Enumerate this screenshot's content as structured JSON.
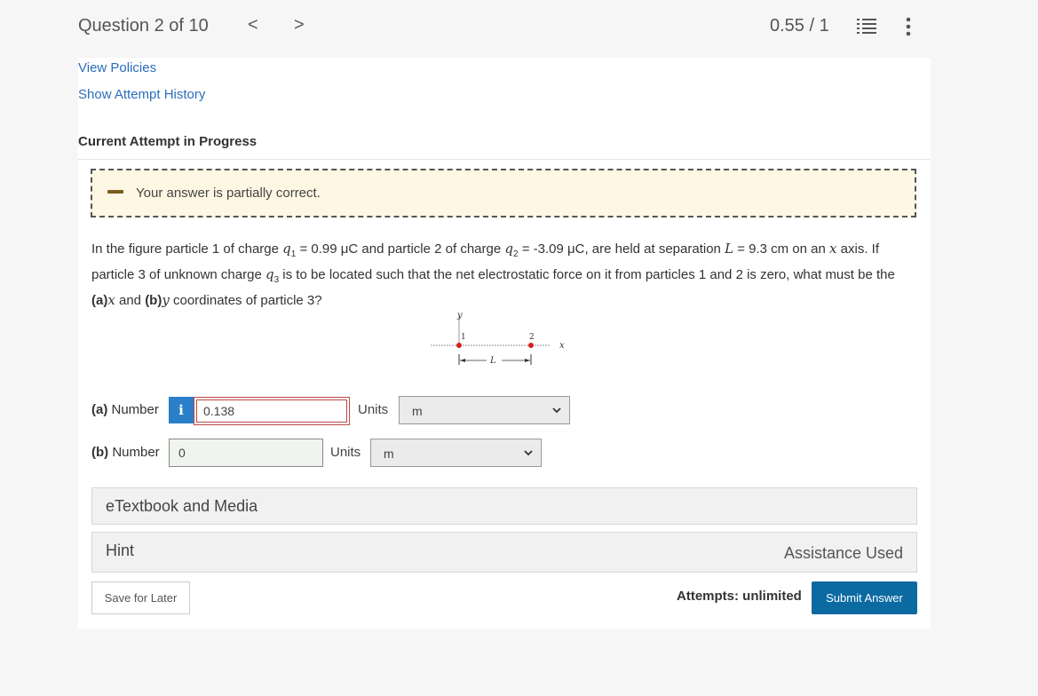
{
  "header": {
    "question_position": "Question 2 of 10",
    "prev_glyph": "<",
    "next_glyph": ">",
    "score": "0.55 / 1",
    "icons": [
      "list-icon",
      "more-vertical-icon"
    ]
  },
  "links": {
    "view_policies": "View Policies",
    "attempt_history": "Show Attempt History"
  },
  "attempt_heading": "Current Attempt in Progress",
  "feedback": {
    "text": "Your answer is partially correct.",
    "icon": "partial-dash-icon"
  },
  "question": {
    "p1": "In the figure particle 1 of charge ",
    "q1_var": "q",
    "q1_sub": "1",
    "q1_val": " = 0.99 μC and particle 2 of charge ",
    "q2_var": "q",
    "q2_sub": "2",
    "q2_val": " = -3.09 μC, are held at separation ",
    "L_var": "L",
    "L_val": " = 9.3 cm on an ",
    "x_var": "x",
    "p2": " axis. If particle 3 of unknown charge ",
    "q3_var": "q",
    "q3_sub": "3",
    "p3": " is to be located such that the net electrostatic force on it from particles 1 and 2 is zero, what must be the ",
    "a_label": "(a)",
    "a_var": "x",
    "p4": " and ",
    "b_label": "(b)",
    "b_var": "y",
    "p5": " coordinates of particle 3?"
  },
  "figure": {
    "y_label": "y",
    "x_label": "x",
    "p1_label": "1",
    "p2_label": "2",
    "L_label": "L",
    "point_color": "#d42020"
  },
  "answers": {
    "a": {
      "label_part": "(a)",
      "label_rest": " Number",
      "value": "0.138",
      "units_label": "Units",
      "unit": "m",
      "info": "i"
    },
    "b": {
      "label_part": "(b)",
      "label_rest": " Number",
      "value": "0",
      "units_label": "Units",
      "unit": "m"
    }
  },
  "media": {
    "label": "eTextbook and Media"
  },
  "hint": {
    "label": "Hint",
    "status": "Assistance Used"
  },
  "footer": {
    "save_label": "Save for Later",
    "attempts": "Attempts: unlimited",
    "submit_label": "Submit Answer"
  },
  "colors": {
    "accent": "#0b6aa2",
    "link": "#2a6ebb",
    "feedback_bg": "#fdf7e3",
    "error_border": "#b94a48"
  }
}
